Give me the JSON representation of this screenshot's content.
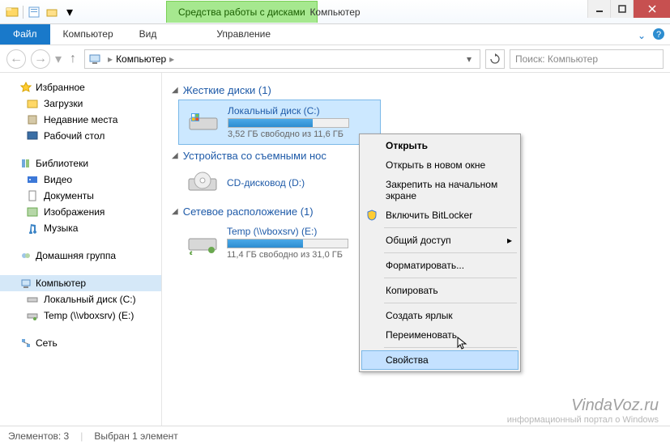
{
  "titlebar": {
    "tool_tab": "Средства работы с дисками",
    "title": "Компьютер"
  },
  "ribbon": {
    "file": "Файл",
    "tabs": [
      "Компьютер",
      "Вид"
    ],
    "tool_subtab": "Управление"
  },
  "nav": {
    "breadcrumb": "Компьютер",
    "search_placeholder": "Поиск: Компьютер"
  },
  "sidebar": {
    "favorites": {
      "header": "Избранное",
      "items": [
        "Загрузки",
        "Недавние места",
        "Рабочий стол"
      ]
    },
    "libraries": {
      "header": "Библиотеки",
      "items": [
        "Видео",
        "Документы",
        "Изображения",
        "Музыка"
      ]
    },
    "homegroup": "Домашняя группа",
    "computer": {
      "header": "Компьютер",
      "items": [
        "Локальный диск (C:)",
        "Temp (\\\\vboxsrv) (E:)"
      ]
    },
    "network": "Сеть"
  },
  "content": {
    "groups": [
      {
        "title": "Жесткие диски (1)",
        "drives": [
          {
            "name": "Локальный диск (C:)",
            "free_text": "3,52 ГБ свободно из 11,6 ГБ",
            "fill_pct": 70,
            "selected": true,
            "type": "hdd"
          }
        ]
      },
      {
        "title": "Устройства со съемными нос",
        "drives": [
          {
            "name": "CD-дисковод (D:)",
            "free_text": "",
            "fill_pct": null,
            "selected": false,
            "type": "cd"
          }
        ]
      },
      {
        "title": "Сетевое расположение (1)",
        "drives": [
          {
            "name": "Temp (\\\\vboxsrv) (E:)",
            "free_text": "11,4 ГБ свободно из 31,0 ГБ",
            "fill_pct": 63,
            "selected": false,
            "type": "net"
          }
        ]
      }
    ]
  },
  "context_menu": {
    "items": [
      {
        "label": "Открыть",
        "bold": true
      },
      {
        "label": "Открыть в новом окне"
      },
      {
        "label": "Закрепить на начальном экране"
      },
      {
        "label": "Включить BitLocker",
        "icon": "shield"
      },
      {
        "sep": true
      },
      {
        "label": "Общий доступ",
        "submenu": true
      },
      {
        "sep": true
      },
      {
        "label": "Форматировать..."
      },
      {
        "sep": true
      },
      {
        "label": "Копировать"
      },
      {
        "sep": true
      },
      {
        "label": "Создать ярлык"
      },
      {
        "label": "Переименовать"
      },
      {
        "sep": true
      },
      {
        "label": "Свойства",
        "hover": true
      }
    ]
  },
  "statusbar": {
    "count": "Элементов: 3",
    "selected": "Выбран 1 элемент"
  },
  "watermark": {
    "title": "VindaVoz.ru",
    "subtitle": "информационный портал о Windows"
  }
}
